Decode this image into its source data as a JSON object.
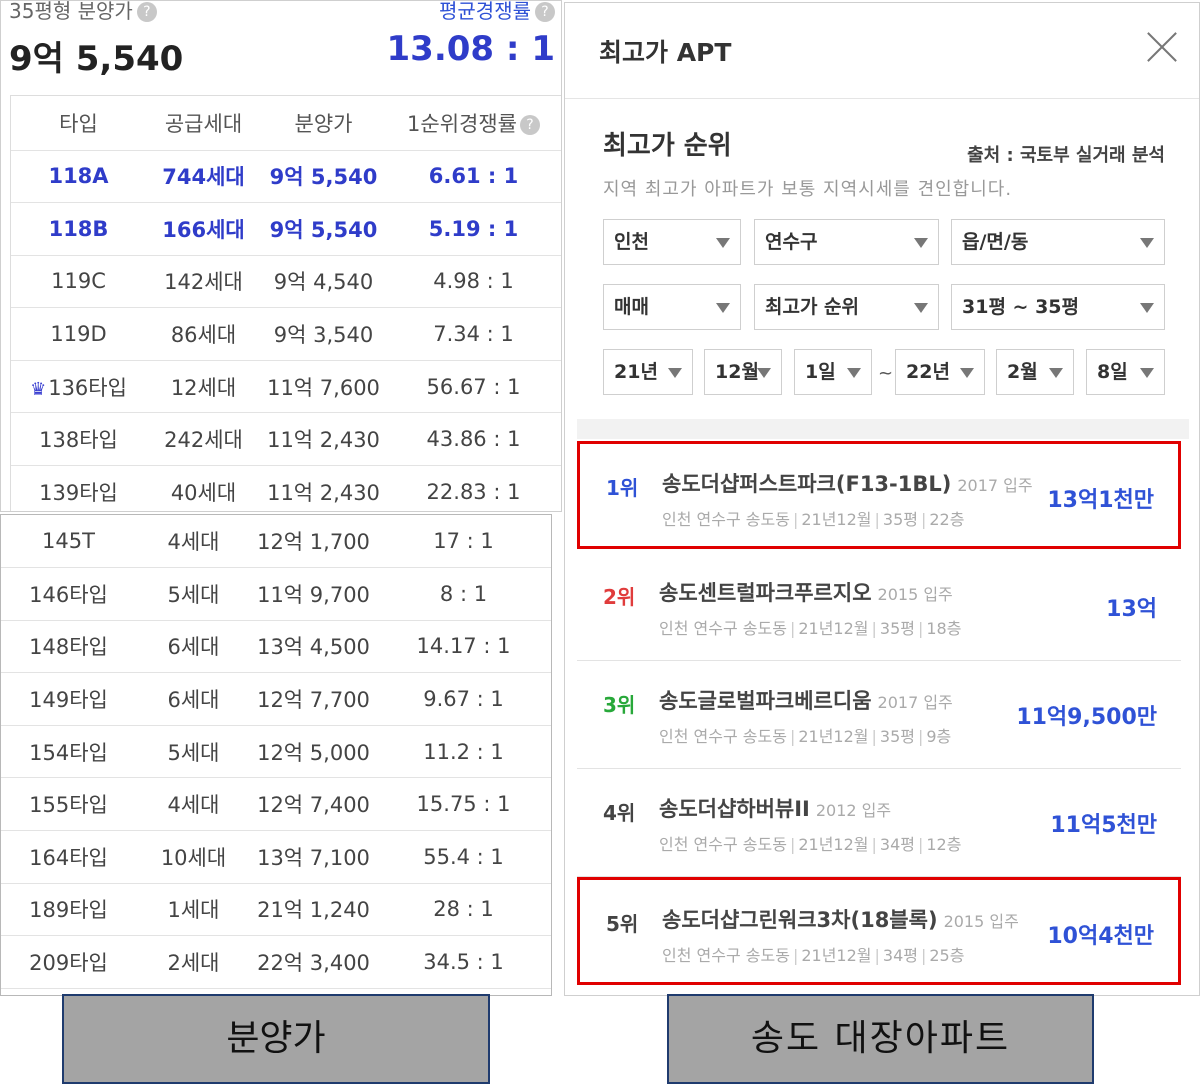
{
  "summary": {
    "price_label": "35평형 분양가",
    "price_value": "9억 5,540",
    "competition_label": "평균경쟁률",
    "competition_value": "13.08 : 1",
    "help_glyph": "?"
  },
  "table": {
    "headers": [
      "타입",
      "공급세대",
      "분양가",
      "1순위경쟁률"
    ],
    "crown_glyph": "♛",
    "rows_top": [
      {
        "type": "118A",
        "units": "744세대",
        "price": "9억 5,540",
        "comp": "6.61 : 1",
        "highlight": true
      },
      {
        "type": "118B",
        "units": "166세대",
        "price": "9억 5,540",
        "comp": "5.19 : 1",
        "highlight": true
      },
      {
        "type": "119C",
        "units": "142세대",
        "price": "9억 4,540",
        "comp": "4.98 : 1"
      },
      {
        "type": "119D",
        "units": "86세대",
        "price": "9억 3,540",
        "comp": "7.34 : 1"
      },
      {
        "type": "136타입",
        "units": "12세대",
        "price": "11억 7,600",
        "comp": "56.67 : 1",
        "crown": true
      },
      {
        "type": "138타입",
        "units": "242세대",
        "price": "11억 2,430",
        "comp": "43.86 : 1"
      },
      {
        "type": "139타입",
        "units": "40세대",
        "price": "11억 2,430",
        "comp": "22.83 : 1"
      }
    ],
    "rows_bottom": [
      {
        "type": "145T",
        "units": "4세대",
        "price": "12억 1,700",
        "comp": "17 : 1"
      },
      {
        "type": "146타입",
        "units": "5세대",
        "price": "11억 9,700",
        "comp": "8 : 1"
      },
      {
        "type": "148타입",
        "units": "6세대",
        "price": "13억 4,500",
        "comp": "14.17 : 1"
      },
      {
        "type": "149타입",
        "units": "6세대",
        "price": "12억 7,700",
        "comp": "9.67 : 1"
      },
      {
        "type": "154타입",
        "units": "5세대",
        "price": "12억 5,000",
        "comp": "11.2 : 1"
      },
      {
        "type": "155타입",
        "units": "4세대",
        "price": "12억 7,400",
        "comp": "15.75 : 1"
      },
      {
        "type": "164타입",
        "units": "10세대",
        "price": "13억 7,100",
        "comp": "55.4 : 1"
      },
      {
        "type": "189타입",
        "units": "1세대",
        "price": "21억 1,240",
        "comp": "28 : 1"
      },
      {
        "type": "209타입",
        "units": "2세대",
        "price": "22억 3,400",
        "comp": "34.5 : 1"
      }
    ]
  },
  "ranking": {
    "title": "최고가 APT",
    "heading": "최고가 순위",
    "source": "출처 : 국토부 실거래 분석",
    "description": "지역 최고가 아파트가 보통 지역시세를 견인합니다.",
    "filters": {
      "city": "인천",
      "district": "연수구",
      "dong": "읍/면/동",
      "trade": "매매",
      "sort": "최고가 순위",
      "size": "31평 ~ 35평",
      "from_year": "21년",
      "from_month": "12월",
      "from_day": "1일",
      "tilde": "~",
      "to_year": "22년",
      "to_month": "2월",
      "to_day": "8일"
    },
    "items": [
      {
        "rank": "1위",
        "name": "송도더샵퍼스트파크(F13-1BL)",
        "year": "2017 입주",
        "region": "인천 연수구 송도동",
        "date": "21년12월",
        "size": "35평",
        "floor": "22층",
        "price": "13억1천만"
      },
      {
        "rank": "2위",
        "name": "송도센트럴파크푸르지오",
        "year": "2015 입주",
        "region": "인천 연수구 송도동",
        "date": "21년12월",
        "size": "35평",
        "floor": "18층",
        "price": "13억"
      },
      {
        "rank": "3위",
        "name": "송도글로벌파크베르디움",
        "year": "2017 입주",
        "region": "인천 연수구 송도동",
        "date": "21년12월",
        "size": "35평",
        "floor": "9층",
        "price": "11억9,500만"
      },
      {
        "rank": "4위",
        "name": "송도더샵하버뷰II",
        "year": "2012 입주",
        "region": "인천 연수구 송도동",
        "date": "21년12월",
        "size": "34평",
        "floor": "12층",
        "price": "11억5천만"
      },
      {
        "rank": "5위",
        "name": "송도더샵그린워크3차(18블록)",
        "year": "2015 입주",
        "region": "인천 연수구 송도동",
        "date": "21년12월",
        "size": "34평",
        "floor": "25층",
        "price": "10억4천만"
      }
    ]
  },
  "captions": {
    "left": "분양가",
    "right": "송도 대장아파트"
  },
  "colors": {
    "accent_blue": "#2f3cc9",
    "rank1": "#2f52d6",
    "rank2": "#e03c3c",
    "rank3": "#28a83a",
    "highlight_box": "#e00000",
    "caption_bg": "#a4a4a4"
  }
}
